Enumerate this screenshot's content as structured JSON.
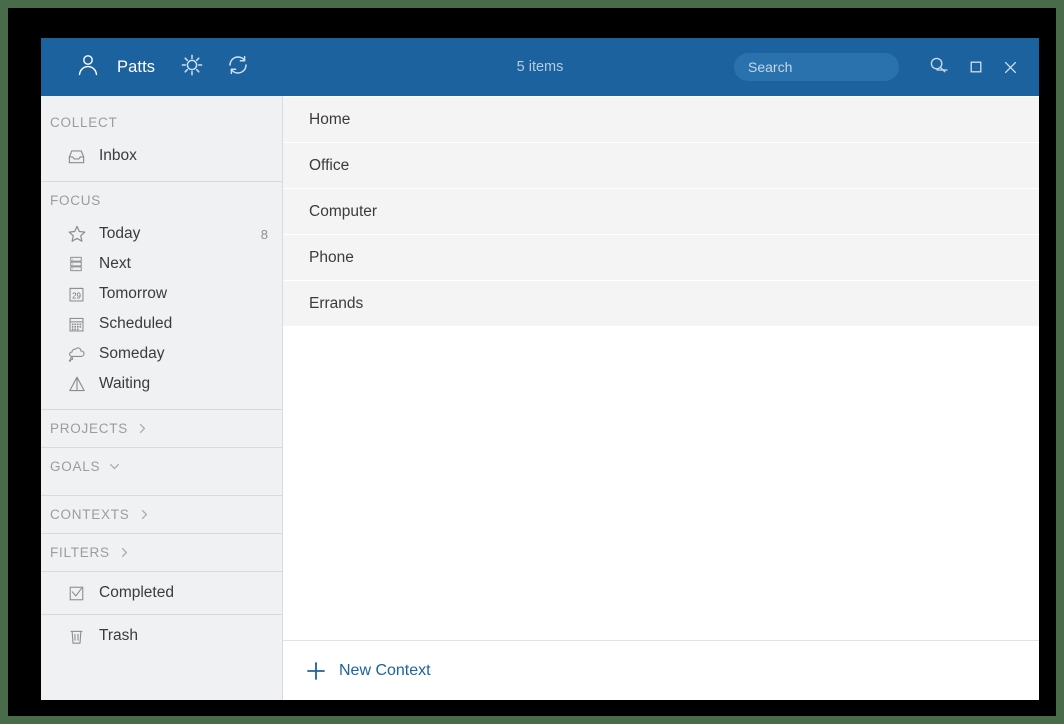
{
  "window": {
    "title_bar": {
      "account_name": "Patts",
      "account_icon": "user-icon",
      "settings_icon": "gear-icon",
      "sync_icon": "refresh-icon",
      "item_count": "5 items",
      "search": {
        "placeholder": "Search",
        "value": "",
        "icon": "search-icon"
      },
      "window_controls": {
        "minimize": "minimize-icon",
        "maximize": "maximize-icon",
        "close": "close-icon"
      }
    },
    "accent_color": "#1b629e",
    "sidebar_bg": "#f0f1f2",
    "row_bg": "#f4f4f4"
  },
  "sidebar": {
    "sections": [
      {
        "header": "COLLECT",
        "chevron": "",
        "items": [
          {
            "label": "Inbox",
            "icon": "inbox-icon",
            "count": ""
          }
        ]
      },
      {
        "header": "FOCUS",
        "chevron": "",
        "items": [
          {
            "label": "Today",
            "icon": "star-icon",
            "count": "8"
          },
          {
            "label": "Next",
            "icon": "list-stack-icon",
            "count": ""
          },
          {
            "label": "Tomorrow",
            "icon": "calendar-29-icon",
            "count": ""
          },
          {
            "label": "Scheduled",
            "icon": "calendar-grid-icon",
            "count": ""
          },
          {
            "label": "Someday",
            "icon": "thought-cloud-icon",
            "count": ""
          },
          {
            "label": "Waiting",
            "icon": "hourglass-icon",
            "count": ""
          }
        ]
      },
      {
        "header": "PROJECTS",
        "chevron": "chevron-right-icon",
        "items": []
      },
      {
        "header": "GOALS",
        "chevron": "chevron-down-icon",
        "items": []
      },
      {
        "header": "CONTEXTS",
        "chevron": "chevron-right-icon",
        "items": []
      },
      {
        "header": "FILTERS",
        "chevron": "chevron-right-icon",
        "items": [
          {
            "label": "Completed",
            "icon": "checkbox-icon",
            "count": ""
          },
          {
            "label": "Trash",
            "icon": "trash-icon",
            "count": ""
          }
        ]
      }
    ]
  },
  "main": {
    "rows": [
      {
        "label": "Home"
      },
      {
        "label": "Office"
      },
      {
        "label": "Computer"
      },
      {
        "label": "Phone"
      },
      {
        "label": "Errands"
      }
    ],
    "footer": {
      "new_context_label": "New Context",
      "plus_icon": "plus-icon"
    }
  }
}
